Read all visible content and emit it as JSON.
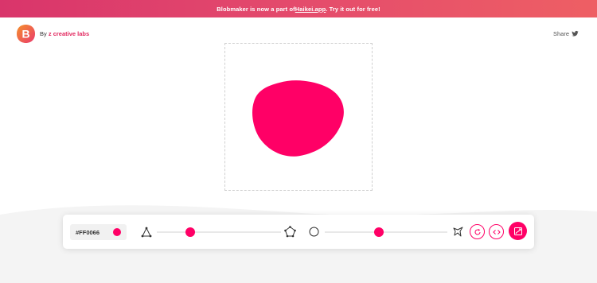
{
  "banner": {
    "prefix": "Blobmaker is now a part of ",
    "link": "Haikei.app",
    "suffix": ". Try it out for free!"
  },
  "header": {
    "logo_letter": "B",
    "by_prefix": "By",
    "brand": "z creative labs",
    "share_label": "Share"
  },
  "blob": {
    "color": "#FF0066"
  },
  "toolbar": {
    "color_value": "#FF0066",
    "complexity_level": 0.25,
    "contrast_level": 0.44
  },
  "colors": {
    "accent": "#ff0066",
    "banner_start": "#d9356b",
    "banner_end": "#ee5f64",
    "logo_orange": "#f5912a"
  },
  "icons": {
    "complexity_min": "triangle-nodes-icon",
    "complexity_max": "star-nodes-icon",
    "contrast_min": "circle-outline-icon",
    "contrast_max": "spiky-shape-icon",
    "regenerate": "refresh-icon",
    "code": "code-icon",
    "download": "download-icon",
    "share": "twitter-icon"
  }
}
